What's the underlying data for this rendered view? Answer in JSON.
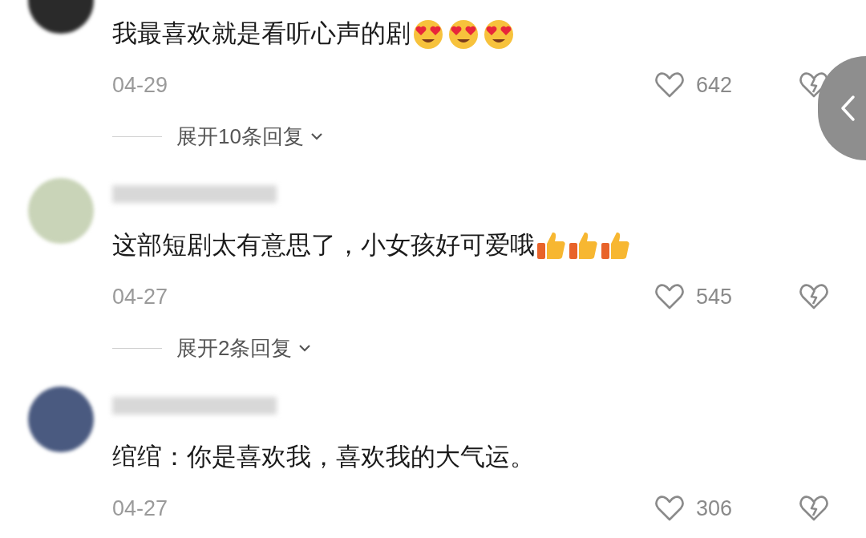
{
  "comments": [
    {
      "text": "我最喜欢就是看听心声的剧",
      "emojis": [
        {
          "kind": "heart-eyes"
        },
        {
          "kind": "heart-eyes"
        },
        {
          "kind": "heart-eyes"
        }
      ],
      "date": "04-29",
      "likes": "642",
      "replies": "展开10条回复"
    },
    {
      "username_blurred": true,
      "text": "这部短剧太有意思了，小女孩好可爱哦",
      "emojis": [
        {
          "kind": "thumbs-up"
        },
        {
          "kind": "thumbs-up"
        },
        {
          "kind": "thumbs-up"
        }
      ],
      "date": "04-27",
      "likes": "545",
      "replies": "展开2条回复"
    },
    {
      "username_blurred": true,
      "text": "绾绾：你是喜欢我，喜欢我的大气运。",
      "date": "04-27",
      "likes": "306"
    }
  ]
}
